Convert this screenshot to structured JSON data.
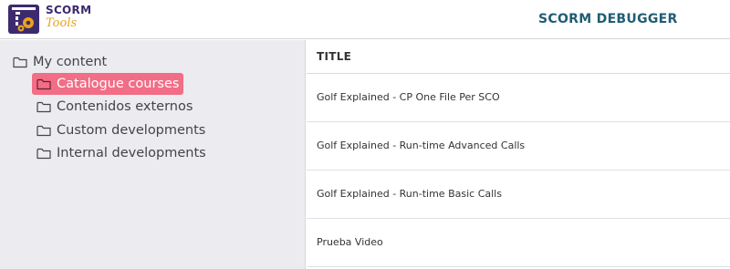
{
  "header": {
    "logo_line1": "SCORM",
    "logo_line2": "Tools",
    "title": "SCORM DEBUGGER"
  },
  "sidebar": {
    "root": {
      "label": "My content",
      "icon": "folder-icon"
    },
    "items": [
      {
        "label": "Catalogue courses",
        "icon": "folder-icon",
        "selected": true
      },
      {
        "label": "Contenidos externos",
        "icon": "folder-icon",
        "selected": false
      },
      {
        "label": "Custom developments",
        "icon": "folder-icon",
        "selected": false
      },
      {
        "label": "Internal developments",
        "icon": "folder-icon",
        "selected": false
      }
    ]
  },
  "table": {
    "columns": [
      "TITLE"
    ],
    "rows": [
      {
        "title": "Golf Explained - CP One File Per SCO"
      },
      {
        "title": "Golf Explained - Run-time Advanced Calls"
      },
      {
        "title": "Golf Explained - Run-time Basic Calls"
      },
      {
        "title": "Prueba Video"
      }
    ]
  },
  "colors": {
    "selected_bg": "#f26d86",
    "title_color": "#1f5d73",
    "sidebar_bg": "#ececf0",
    "logo_purple": "#3d2a6e",
    "logo_orange": "#e8a21d"
  }
}
